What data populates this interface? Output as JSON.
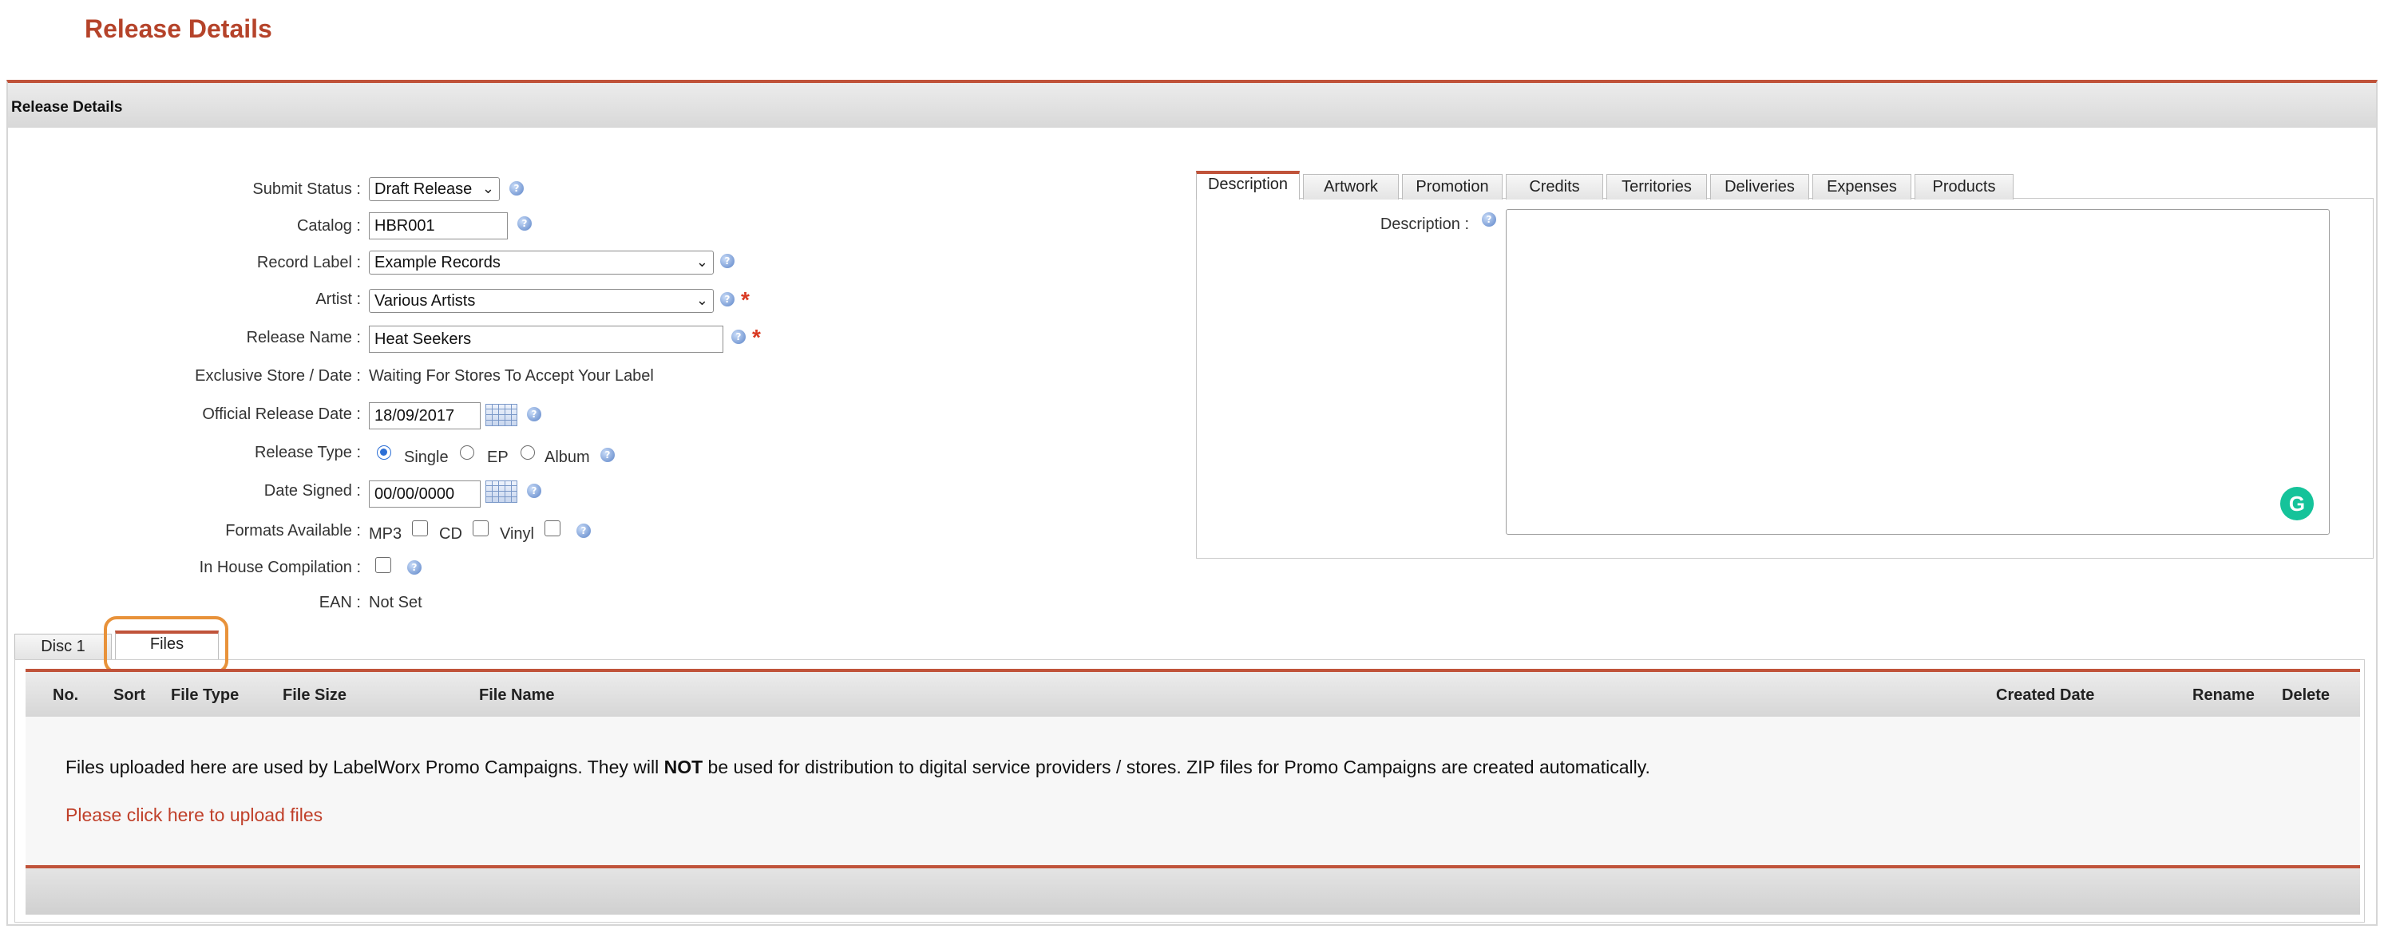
{
  "page": {
    "title": "Release Details"
  },
  "panel": {
    "header": "Release Details"
  },
  "form": {
    "submit_status": {
      "label": "Submit Status :",
      "value": "Draft Release"
    },
    "catalog": {
      "label": "Catalog :",
      "value": "HBR001"
    },
    "record_label": {
      "label": "Record Label :",
      "value": "Example Records"
    },
    "artist": {
      "label": "Artist :",
      "value": "Various Artists"
    },
    "release_name": {
      "label": "Release Name :",
      "value": "Heat Seekers"
    },
    "exclusive": {
      "label": "Exclusive Store / Date :",
      "value": "Waiting For Stores To Accept Your Label"
    },
    "official_date": {
      "label": "Official Release Date :",
      "value": "18/09/2017"
    },
    "release_type": {
      "label": "Release Type :",
      "options": [
        "Single",
        "EP",
        "Album"
      ],
      "selected": "Single"
    },
    "date_signed": {
      "label": "Date Signed :",
      "value": "00/00/0000"
    },
    "formats": {
      "label": "Formats Available :",
      "options": [
        "MP3",
        "CD",
        "Vinyl"
      ]
    },
    "in_house": {
      "label": "In House Compilation :"
    },
    "ean": {
      "label": "EAN :",
      "value": "Not Set"
    }
  },
  "right_tabs": {
    "items": [
      "Description",
      "Artwork",
      "Promotion",
      "Credits",
      "Territories",
      "Deliveries",
      "Expenses",
      "Products"
    ],
    "active": "Description",
    "description_label": "Description :",
    "description_value": ""
  },
  "lower_tabs": {
    "items": [
      "Disc 1",
      "Files"
    ],
    "active": "Files"
  },
  "files_table": {
    "columns": [
      "No.",
      "Sort",
      "File Type",
      "File Size",
      "File Name",
      "Created Date",
      "Rename",
      "Delete"
    ],
    "note_before": "Files uploaded here are used by LabelWorx Promo Campaigns. They will ",
    "note_bold": "NOT",
    "note_after": " be used for distribution to digital service providers / stores. ZIP files for Promo Campaigns are created automatically.",
    "upload_link": "Please click here to upload files"
  },
  "colors": {
    "accent": "#c0533a",
    "title": "#b5432a",
    "highlight": "#e8923a",
    "link": "#c0402a"
  },
  "icons": {
    "help": "help-icon",
    "calendar": "calendar-icon",
    "grammarly": "grammarly-icon"
  }
}
